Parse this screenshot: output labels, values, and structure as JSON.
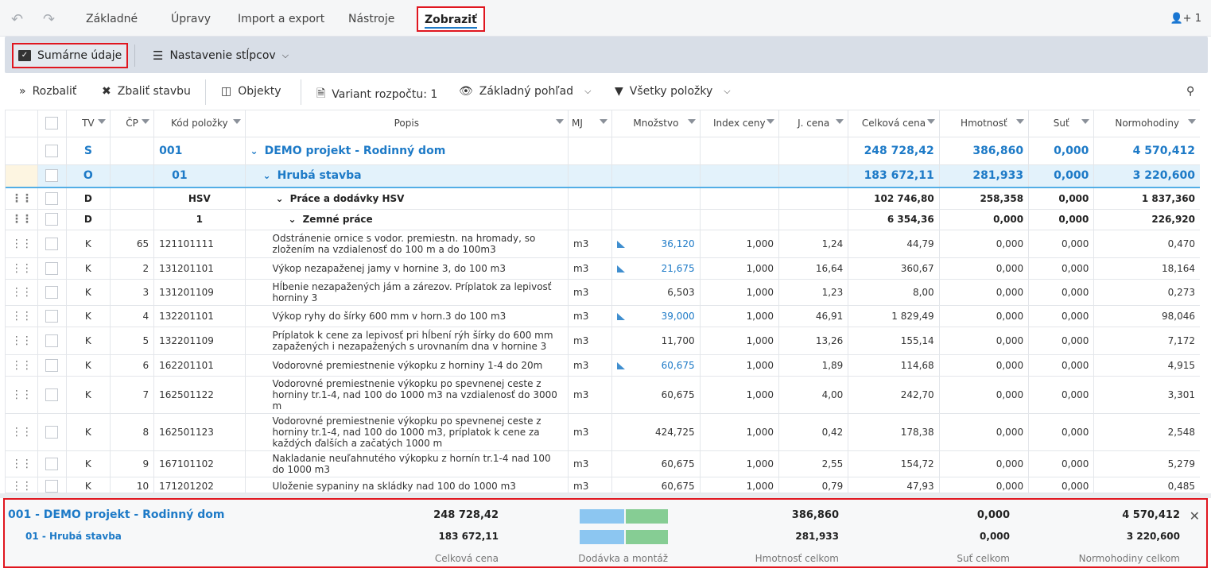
{
  "tabs": [
    "Základné",
    "Úpravy",
    "Import a export",
    "Nástroje",
    "Zobraziť"
  ],
  "active_tab": "Zobraziť",
  "user_count": "1",
  "ribbon": {
    "summary": "Sumárne údaje",
    "columns": "Nastavenie stĺpcov"
  },
  "toolbar": {
    "expand": "Rozbaliť",
    "collapse": "Zbaliť stavbu",
    "objects": "Objekty",
    "variant": "Variant rozpočtu: 1",
    "view": "Základný pohľad",
    "filter": "Všetky položky"
  },
  "columns": [
    "TV",
    "ČP",
    "Kód položky",
    "Popis",
    "MJ",
    "Množstvo",
    "Index ceny",
    "J. cena",
    "Celková cena",
    "Hmotnosť",
    "Suť",
    "Normohodiny"
  ],
  "rows": [
    {
      "level": "S",
      "tv": "S",
      "cp": "",
      "code": "001",
      "desc": "DEMO projekt - Rodinný dom",
      "mj": "",
      "qty": "",
      "idx": "",
      "price": "",
      "total": "248 728,42",
      "weight": "386,860",
      "sut": "0,000",
      "hours": "4 570,412"
    },
    {
      "level": "O",
      "tv": "O",
      "cp": "",
      "code": "01",
      "desc": "Hrubá stavba",
      "mj": "",
      "qty": "",
      "idx": "",
      "price": "",
      "total": "183 672,11",
      "weight": "281,933",
      "sut": "0,000",
      "hours": "3 220,600"
    },
    {
      "level": "D",
      "tv": "D",
      "cp": "",
      "code": "HSV",
      "desc": "Práce a dodávky HSV",
      "mj": "",
      "qty": "",
      "idx": "",
      "price": "",
      "total": "102 746,80",
      "weight": "258,358",
      "sut": "0,000",
      "hours": "1 837,360"
    },
    {
      "level": "D2",
      "tv": "D",
      "cp": "",
      "code": "1",
      "desc": "Zemné práce",
      "mj": "",
      "qty": "",
      "idx": "",
      "price": "",
      "total": "6 354,36",
      "weight": "0,000",
      "sut": "0,000",
      "hours": "226,920"
    },
    {
      "level": "K",
      "tv": "K",
      "cp": "65",
      "code": "121101111",
      "desc": "Odstránenie ornice s vodor. premiestn. na hromady, so zložením na vzdialenosť do 100 m a do 100m3",
      "mj": "m3",
      "qty": "36,120",
      "qtyLink": true,
      "idx": "1,000",
      "price": "1,24",
      "total": "44,79",
      "weight": "0,000",
      "sut": "0,000",
      "hours": "0,470"
    },
    {
      "level": "K",
      "tv": "K",
      "cp": "2",
      "code": "131201101",
      "desc": "Výkop nezapaženej jamy v hornine 3, do 100 m3",
      "mj": "m3",
      "qty": "21,675",
      "qtyLink": true,
      "idx": "1,000",
      "price": "16,64",
      "total": "360,67",
      "weight": "0,000",
      "sut": "0,000",
      "hours": "18,164"
    },
    {
      "level": "K",
      "tv": "K",
      "cp": "3",
      "code": "131201109",
      "desc": "Hĺbenie nezapažených jám a zárezov. Príplatok za lepivosť horniny 3",
      "mj": "m3",
      "qty": "6,503",
      "idx": "1,000",
      "price": "1,23",
      "total": "8,00",
      "weight": "0,000",
      "sut": "0,000",
      "hours": "0,273"
    },
    {
      "level": "K",
      "tv": "K",
      "cp": "4",
      "code": "132201101",
      "desc": "Výkop ryhy do šírky 600 mm v horn.3 do 100 m3",
      "mj": "m3",
      "qty": "39,000",
      "qtyLink": true,
      "idx": "1,000",
      "price": "46,91",
      "total": "1 829,49",
      "weight": "0,000",
      "sut": "0,000",
      "hours": "98,046"
    },
    {
      "level": "K",
      "tv": "K",
      "cp": "5",
      "code": "132201109",
      "desc": "Príplatok k cene za lepivosť pri hĺbení rýh šírky do 600 mm zapažených i nezapažených s urovnaním dna v hornine 3",
      "mj": "m3",
      "qty": "11,700",
      "idx": "1,000",
      "price": "13,26",
      "total": "155,14",
      "weight": "0,000",
      "sut": "0,000",
      "hours": "7,172"
    },
    {
      "level": "K",
      "tv": "K",
      "cp": "6",
      "code": "162201101",
      "desc": "Vodorovné premiestnenie výkopku z horniny 1-4 do 20m",
      "mj": "m3",
      "qty": "60,675",
      "qtyLink": true,
      "idx": "1,000",
      "price": "1,89",
      "total": "114,68",
      "weight": "0,000",
      "sut": "0,000",
      "hours": "4,915"
    },
    {
      "level": "K",
      "tv": "K",
      "cp": "7",
      "code": "162501122",
      "desc": "Vodorovné premiestnenie výkopku po spevnenej ceste z horniny tr.1-4, nad 100 do 1000 m3 na vzdialenosť do 3000 m",
      "mj": "m3",
      "qty": "60,675",
      "idx": "1,000",
      "price": "4,00",
      "total": "242,70",
      "weight": "0,000",
      "sut": "0,000",
      "hours": "3,301"
    },
    {
      "level": "K",
      "tv": "K",
      "cp": "8",
      "code": "162501123",
      "desc": "Vodorovné premiestnenie výkopku po spevnenej ceste z horniny tr.1-4, nad 100 do 1000 m3, príplatok k cene za každých ďalších a začatých 1000 m",
      "mj": "m3",
      "qty": "424,725",
      "idx": "1,000",
      "price": "0,42",
      "total": "178,38",
      "weight": "0,000",
      "sut": "0,000",
      "hours": "2,548"
    },
    {
      "level": "K",
      "tv": "K",
      "cp": "9",
      "code": "167101102",
      "desc": "Nakladanie neuľahnutého výkopku z hornín tr.1-4 nad 100 do 1000 m3",
      "mj": "m3",
      "qty": "60,675",
      "idx": "1,000",
      "price": "2,55",
      "total": "154,72",
      "weight": "0,000",
      "sut": "0,000",
      "hours": "5,279"
    },
    {
      "level": "K",
      "tv": "K",
      "cp": "10",
      "code": "171201202",
      "desc": "Uloženie sypaniny na skládky nad 100 do 1000 m3",
      "mj": "m3",
      "qty": "60,675",
      "idx": "1,000",
      "price": "0,79",
      "total": "47,93",
      "weight": "0,000",
      "sut": "0,000",
      "hours": "0,485"
    }
  ],
  "summary": {
    "project": {
      "title": "001 - DEMO projekt - Rodinný dom",
      "total": "248 728,42",
      "weight": "386,860",
      "sut": "0,000",
      "hours": "4 570,412"
    },
    "object": {
      "title": "01 - Hrubá stavba",
      "total": "183 672,11",
      "weight": "281,933",
      "sut": "0,000",
      "hours": "3 220,600"
    },
    "labels": {
      "total": "Celková cena",
      "bar": "Dodávka a montáž",
      "weight": "Hmotnosť celkom",
      "sut": "Suť celkom",
      "hours": "Normohodiny celkom"
    },
    "bar_colors": {
      "delivery": "#8cc6f1",
      "assembly": "#86cd94"
    }
  },
  "colors": {
    "accent": "#1d7ac7",
    "highlight_border": "#e0161f"
  }
}
